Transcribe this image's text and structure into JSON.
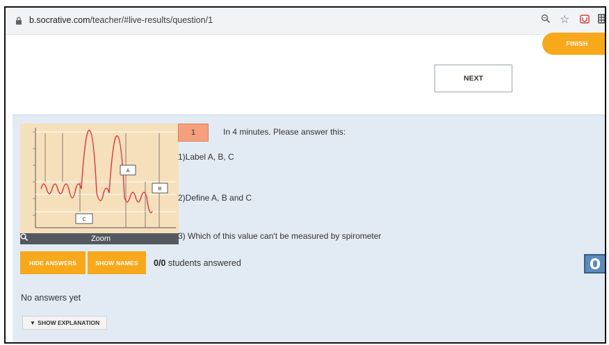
{
  "browser": {
    "url_host": "b.socrative.com",
    "url_path": "/teacher/#live-results/question/1"
  },
  "header": {
    "finish_label": "FINISH",
    "next_label": "NEXT"
  },
  "question": {
    "number": "1",
    "intro": "In 4 minutes. Please answer this:",
    "line1": "1)Label A, B, C",
    "line2": "2)Define A, B and C",
    "line3": "3) Which of this value can't be measured by spirometer",
    "zoom_label": "Zoom",
    "diagram_labels": {
      "a": "A",
      "b": "B",
      "c": "C"
    }
  },
  "results": {
    "hide_answers_label": "HIDE ANSWERS",
    "show_names_label": "SHOW NAMES",
    "answered_count": "0/0",
    "answered_suffix": " students answered",
    "no_answers_text": "No answers yet",
    "show_explanation_label": "SHOW EXPLANATION",
    "show_explanation_icon": "▼"
  },
  "colors": {
    "accent_orange": "#f7a81b",
    "panel_bg": "#e2ebf4",
    "question_number_bg": "#f4a07c"
  },
  "icons": [
    "lock-icon",
    "magnifier-icon",
    "star-icon",
    "extension-icon",
    "grid-icon",
    "search-zoom-icon",
    "toggle-icon",
    "caret-down-icon"
  ]
}
